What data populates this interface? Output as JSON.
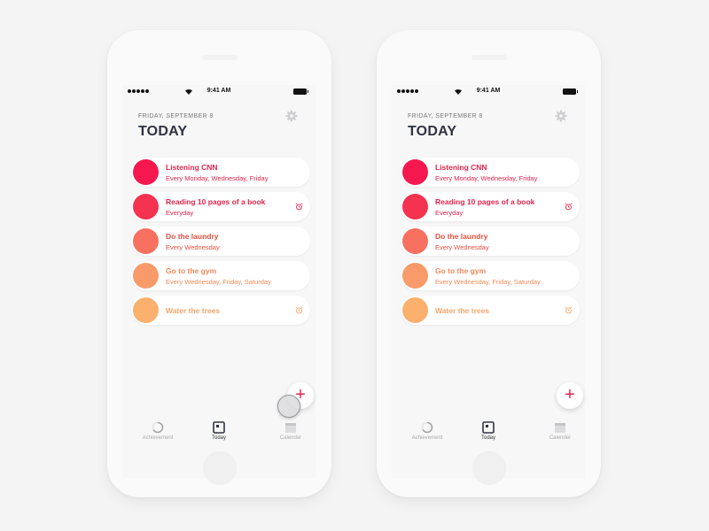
{
  "status_bar": {
    "time": "9:41 AM"
  },
  "header": {
    "date": "FRIDAY, SEPTEMBER 8",
    "title": "TODAY"
  },
  "tasks": [
    {
      "title": "Listening CNN",
      "subtitle": "Every Monday, Wednesday, Friday",
      "color": "#f5184f",
      "alarm": false
    },
    {
      "title": "Reading 10 pages of a book",
      "subtitle": "Everyday",
      "color": "#f5324f",
      "alarm": true
    },
    {
      "title": "Do the laundry",
      "subtitle": "Every Wednesday",
      "color": "#f87060",
      "alarm": false
    },
    {
      "title": "Go to the gym",
      "subtitle": "Every Wednesday, Friday, Saturday",
      "color": "#f99a6a",
      "alarm": false
    },
    {
      "title": "Water the trees",
      "subtitle": "",
      "color": "#fbb06e",
      "alarm": true
    }
  ],
  "text_colors": [
    "#e3244e",
    "#e3244e",
    "#e2503f",
    "#ef8a59",
    "#f4a56a"
  ],
  "add_button": {
    "label": "+"
  },
  "tabs": [
    {
      "label": "Achievement",
      "icon": "progress-ring-icon",
      "active": false
    },
    {
      "label": "Today",
      "icon": "today-square-icon",
      "active": true
    },
    {
      "label": "Calender",
      "icon": "calendar-icon",
      "active": false
    }
  ]
}
